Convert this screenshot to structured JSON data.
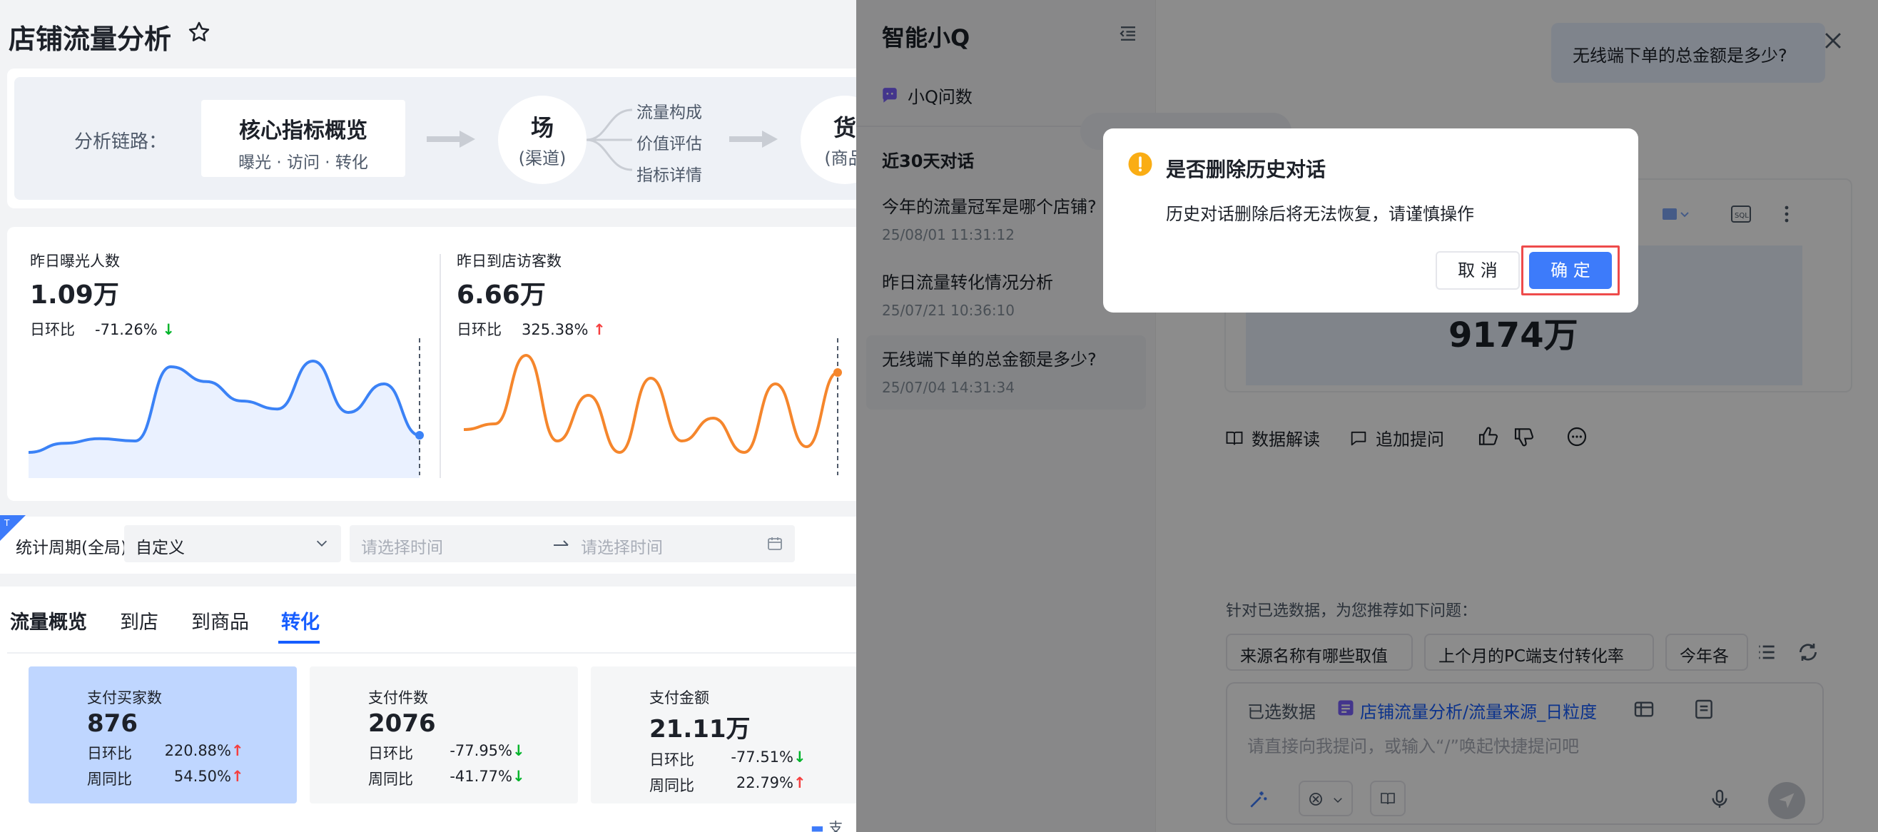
{
  "page": {
    "title": "店铺流量分析"
  },
  "chain": {
    "label": "分析链路：",
    "core_title": "核心指标概览",
    "core_sub": "曝光 · 访问 · 转化",
    "node1_big": "场",
    "node1_small": "(渠道)",
    "branches": [
      "流量构成",
      "价值评估",
      "指标详情"
    ],
    "node2_big": "货",
    "node2_small": "(商品"
  },
  "metrics": [
    {
      "label": "昨日曝光人数",
      "value": "1.09万",
      "ratio_label": "日环比",
      "ratio": "-71.26%",
      "dir": "down",
      "trend": [
        0.1,
        0.18,
        0.22,
        0.2,
        0.85,
        0.72,
        0.55,
        0.48,
        0.9,
        0.45,
        0.7,
        0.25
      ],
      "color": "#3b82f6"
    },
    {
      "label": "昨日到店访客数",
      "value": "6.66万",
      "ratio_label": "日环比",
      "ratio": "325.38%",
      "dir": "up",
      "trend": [
        0.3,
        0.35,
        0.95,
        0.2,
        0.6,
        0.1,
        0.75,
        0.2,
        0.4,
        0.1,
        0.7,
        0.15,
        0.8
      ],
      "color": "#f5862c"
    }
  ],
  "filter": {
    "label": "统计周期(全局)",
    "select_value": "自定义",
    "start_placeholder": "请选择时间",
    "end_placeholder": "请选择时间"
  },
  "tabs": [
    "流量概览",
    "到店",
    "到商品",
    "转化"
  ],
  "kpis": [
    {
      "label": "支付买家数",
      "value": "876",
      "d_label": "日环比",
      "d_val": "220.88%",
      "d_dir": "up",
      "w_label": "周同比",
      "w_val": "54.50%",
      "w_dir": "up"
    },
    {
      "label": "支付件数",
      "value": "2076",
      "d_label": "日环比",
      "d_val": "-77.95%",
      "d_dir": "down",
      "w_label": "周同比",
      "w_val": "-41.77%",
      "w_dir": "down"
    },
    {
      "label": "支付金额",
      "value": "21.11万",
      "d_label": "日环比",
      "d_val": "-77.51%",
      "d_dir": "down",
      "w_label": "周同比",
      "w_val": "22.79%",
      "w_dir": "up"
    }
  ],
  "legend_stub": "支付",
  "drawer": {
    "title": "智能小Q",
    "ask_label": "小Q问数",
    "section": "近30天对话",
    "conversations": [
      {
        "title": "今年的流量冠军是哪个店铺?",
        "time": "25/08/01 11:31:12"
      },
      {
        "title": "昨日流量转化情况分析",
        "time": "25/07/21 10:36:10"
      },
      {
        "title": "无线端下单的总金额是多少?",
        "time": "25/07/04 14:31:34"
      }
    ]
  },
  "chat": {
    "user_question": "无线端下单的总金额是多少?",
    "answer_value": "9174万",
    "actions": [
      "数据解读",
      "追加提问"
    ],
    "suggest_hint": "针对已选数据，为您推荐如下问题：",
    "chips": [
      "来源名称有哪些取值",
      "上个月的PC端支付转化率",
      "今年各"
    ],
    "selected_label": "已选数据",
    "selected_name": "店铺流量分析/流量来源_日粒度",
    "input_placeholder": "请直接向我提问，或输入“/”唤起快捷提问吧"
  },
  "modal": {
    "title": "是否删除历史对话",
    "body": "历史对话删除后将无法恢复，请谨慎操作",
    "cancel": "取 消",
    "ok": "确 定"
  },
  "colors": {
    "accent": "#165dff",
    "warning": "#faad14",
    "up": "#f53f3f",
    "down": "#00b42a"
  }
}
